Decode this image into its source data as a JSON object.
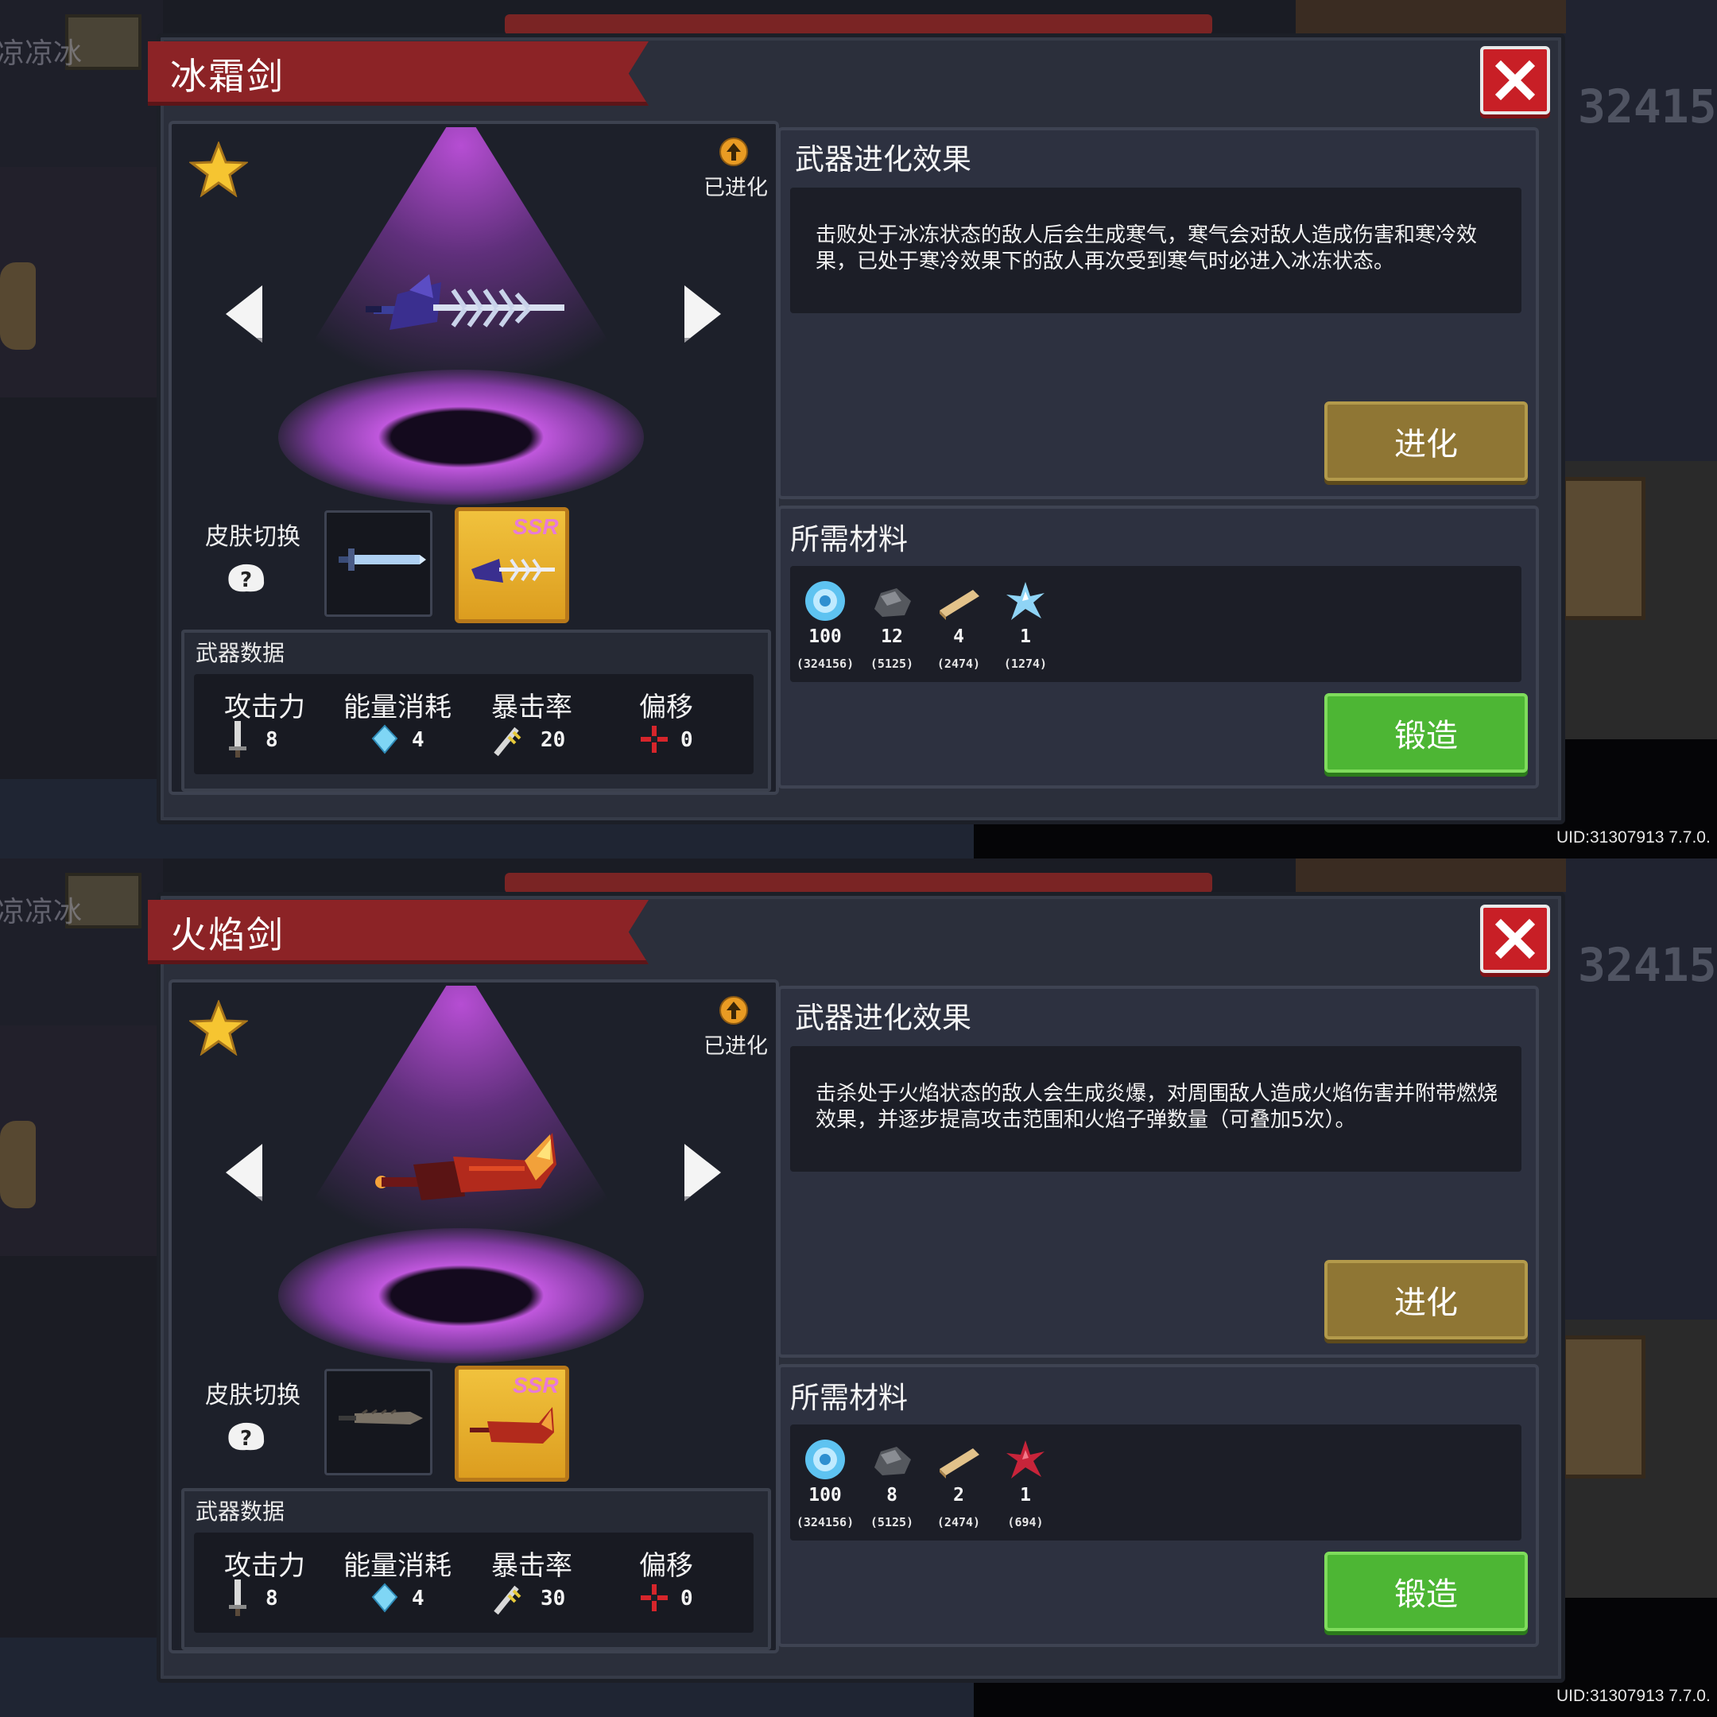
{
  "screens": [
    {
      "weapon_name": "冰霜剑",
      "evolved_label": "已进化",
      "skin_label": "皮肤切换",
      "skin_badge": "SSR",
      "stats_title": "武器数据",
      "stats": [
        {
          "label": "攻击力",
          "value": "8",
          "icon": "sword-icon"
        },
        {
          "label": "能量消耗",
          "value": "4",
          "icon": "energy-crystal-icon"
        },
        {
          "label": "暴击率",
          "value": "20",
          "icon": "crit-icon"
        },
        {
          "label": "偏移",
          "value": "0",
          "icon": "crosshair-icon"
        }
      ],
      "effect_title": "武器进化效果",
      "effect_text": "击败处于冰冻状态的敌人后会生成寒气，寒气会对敌人造成伤害和寒冷效果，已处于寒冷效果下的敌人再次受到寒气时必进入冰冻状态。",
      "evolve_label": "进化",
      "materials_title": "所需材料",
      "materials": [
        {
          "icon": "blue-gem-icon",
          "count": "100",
          "stock": "(324156)"
        },
        {
          "icon": "iron-ore-icon",
          "count": "12",
          "stock": "(5125)"
        },
        {
          "icon": "wood-plank-icon",
          "count": "4",
          "stock": "(2474)"
        },
        {
          "icon": "ice-crystal-icon",
          "count": "1",
          "stock": "(1274)"
        }
      ],
      "forge_label": "锻造",
      "uid": "UID:31307913 7.7.0.",
      "theme": "ice"
    },
    {
      "weapon_name": "火焰剑",
      "evolved_label": "已进化",
      "skin_label": "皮肤切换",
      "skin_badge": "SSR",
      "stats_title": "武器数据",
      "stats": [
        {
          "label": "攻击力",
          "value": "8",
          "icon": "sword-icon"
        },
        {
          "label": "能量消耗",
          "value": "4",
          "icon": "energy-crystal-icon"
        },
        {
          "label": "暴击率",
          "value": "30",
          "icon": "crit-icon"
        },
        {
          "label": "偏移",
          "value": "0",
          "icon": "crosshair-icon"
        }
      ],
      "effect_title": "武器进化效果",
      "effect_text": "击杀处于火焰状态的敌人会生成炎爆，对周围敌人造成火焰伤害并附带燃烧效果，并逐步提高攻击范围和火焰子弹数量（可叠加5次）。",
      "evolve_label": "进化",
      "materials_title": "所需材料",
      "materials": [
        {
          "icon": "blue-gem-icon",
          "count": "100",
          "stock": "(324156)"
        },
        {
          "icon": "iron-ore-icon",
          "count": "8",
          "stock": "(5125)"
        },
        {
          "icon": "wood-plank-icon",
          "count": "2",
          "stock": "(2474)"
        },
        {
          "icon": "red-crystal-icon",
          "count": "1",
          "stock": "(694)"
        }
      ],
      "forge_label": "锻造",
      "uid": "UID:31307913 7.7.0.",
      "theme": "fire"
    }
  ],
  "background": {
    "left_fragment": "凉凉冰",
    "right_fragment": "32415"
  },
  "colors": {
    "title_banner": "#8c2326",
    "close_button": "#c81f26",
    "evolve_button": "#8f7634",
    "forge_button": "#4db634",
    "beam": "#be50dc",
    "ssr_slot": "#f1c23d"
  }
}
